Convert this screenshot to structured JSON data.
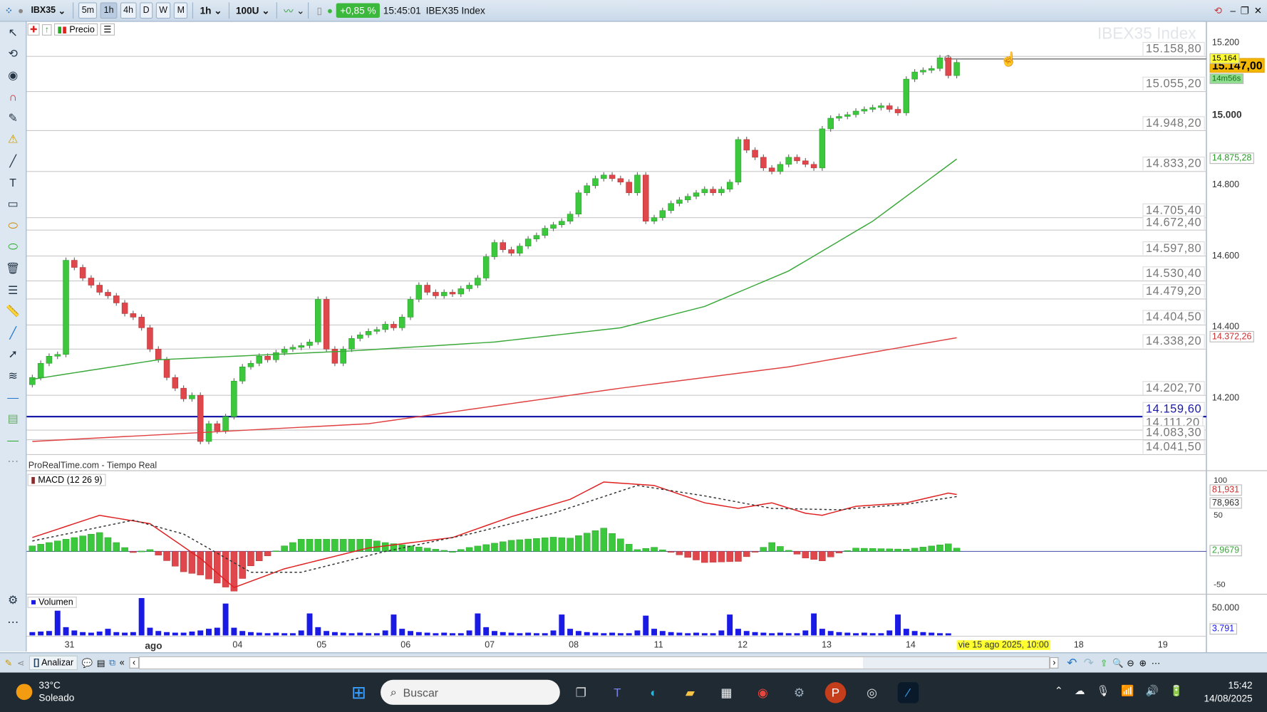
{
  "toolbar": {
    "symbol": "IBX35",
    "timeframes": [
      "5m",
      "1h",
      "4h",
      "D",
      "W",
      "M"
    ],
    "active_timeframe": "1h",
    "interval": "1h",
    "units": "100U",
    "change": "+0,85 %",
    "time": "15:45:01",
    "instrument": "IBEX35 Index"
  },
  "chart_header": {
    "price_label": "Precio",
    "watermark": "IBEX35 Index",
    "source": "ProRealTime.com - Tiempo Real"
  },
  "colors": {
    "up": "#3cc83c",
    "down": "#e0474c",
    "ma_fast": "#3aa83a",
    "ma_slow": "#e04040",
    "level_blue": "#1a1aa8",
    "volume": "#1a1ae6"
  },
  "levels": [
    {
      "label": "15.158,80",
      "price": 15164
    },
    {
      "label": "15.055,20",
      "price": 15065
    },
    {
      "label": "14.948,20",
      "price": 14955
    },
    {
      "label": "14.833,20",
      "price": 14840
    },
    {
      "label": "14.705,40",
      "price": 14710
    },
    {
      "label": "14.672,40",
      "price": 14675
    },
    {
      "label": "14.597,80",
      "price": 14602
    },
    {
      "label": "14.530,40",
      "price": 14532
    },
    {
      "label": "14.479,20",
      "price": 14481
    },
    {
      "label": "14.404,50",
      "price": 14408
    },
    {
      "label": "14.338,20",
      "price": 14340
    },
    {
      "label": "14.202,70",
      "price": 14210
    },
    {
      "label": "14.159,60",
      "price": 14150,
      "blue": true
    },
    {
      "label": "14.111,20",
      "price": 14112
    },
    {
      "label": "14.083,30",
      "price": 14085
    },
    {
      "label": "14.041,50",
      "price": 14043
    }
  ],
  "price_axis": {
    "ticks": [
      {
        "label": "15.200",
        "v": 15200
      },
      {
        "label": "15.000",
        "v": 15000,
        "bold": true
      },
      {
        "label": "14.800",
        "v": 14800
      },
      {
        "label": "14.600",
        "v": 14600
      },
      {
        "label": "14.400",
        "v": 14400
      },
      {
        "label": "14.200",
        "v": 14200
      }
    ],
    "last_price": "15.147,00",
    "crosshair_price": "15.164",
    "countdown": "14m56s",
    "ma_fast_value": "14.875,28",
    "ma_slow_value": "14.372,26"
  },
  "macd": {
    "title": "MACD (12 26 9)",
    "ticks": [
      {
        "label": "100",
        "v": 100
      },
      {
        "label": "50",
        "v": 50
      },
      {
        "label": "-50",
        "v": -50
      }
    ],
    "macd_value": "81,931",
    "signal_value": "78,963",
    "hist_value": "2,9679"
  },
  "volume": {
    "title": "Volumen",
    "tick": "50.000",
    "last": "3.791"
  },
  "date_axis": {
    "labels": [
      "31",
      "ago",
      "04",
      "05",
      "06",
      "07",
      "08",
      "11",
      "12",
      "13",
      "14",
      "18",
      "19"
    ],
    "cursor_label": "vie 15 ago 2025, 10:00"
  },
  "bottom": {
    "analyze": "Analizar"
  },
  "taskbar": {
    "temp": "33°C",
    "weather": "Soleado",
    "search": "Buscar",
    "time": "15:42",
    "date": "14/08/2025"
  },
  "chart_data": {
    "type": "candlestick",
    "title": "IBEX35 Index 1h",
    "ylabel": "Precio",
    "ylim": [
      14000,
      15230
    ],
    "closes": [
      14260,
      14300,
      14320,
      14325,
      14590,
      14570,
      14540,
      14520,
      14500,
      14490,
      14470,
      14440,
      14430,
      14400,
      14340,
      14310,
      14260,
      14230,
      14200,
      14210,
      14080,
      14130,
      14110,
      14150,
      14250,
      14290,
      14300,
      14320,
      14310,
      14330,
      14340,
      14345,
      14350,
      14360,
      14480,
      14340,
      14300,
      14340,
      14370,
      14380,
      14390,
      14395,
      14410,
      14400,
      14430,
      14480,
      14520,
      14500,
      14490,
      14500,
      14495,
      14510,
      14520,
      14540,
      14600,
      14640,
      14620,
      14610,
      14630,
      14650,
      14660,
      14680,
      14690,
      14700,
      14720,
      14780,
      14800,
      14820,
      14830,
      14820,
      14810,
      14780,
      14830,
      14700,
      14710,
      14730,
      14750,
      14760,
      14770,
      14780,
      14790,
      14780,
      14790,
      14810,
      14930,
      14900,
      14880,
      14850,
      14840,
      14860,
      14880,
      14870,
      14860,
      14850,
      14960,
      14990,
      14995,
      15000,
      15010,
      15015,
      15020,
      15025,
      15015,
      15005,
      15100,
      15120,
      15125,
      15130,
      15160,
      15110,
      15147
    ],
    "ma_fast": [
      [
        0,
        14255
      ],
      [
        15,
        14310
      ],
      [
        38,
        14335
      ],
      [
        55,
        14360
      ],
      [
        70,
        14400
      ],
      [
        80,
        14460
      ],
      [
        90,
        14560
      ],
      [
        100,
        14700
      ],
      [
        110,
        14875
      ]
    ],
    "ma_slow": [
      [
        0,
        14080
      ],
      [
        40,
        14130
      ],
      [
        70,
        14230
      ],
      [
        90,
        14290
      ],
      [
        110,
        14372
      ]
    ],
    "macd_line": [
      [
        0,
        20
      ],
      [
        8,
        52
      ],
      [
        14,
        40
      ],
      [
        20,
        -10
      ],
      [
        24,
        -52
      ],
      [
        30,
        -25
      ],
      [
        40,
        5
      ],
      [
        50,
        20
      ],
      [
        57,
        50
      ],
      [
        64,
        75
      ],
      [
        68,
        100
      ],
      [
        74,
        95
      ],
      [
        80,
        70
      ],
      [
        84,
        62
      ],
      [
        88,
        70
      ],
      [
        92,
        55
      ],
      [
        94,
        52
      ],
      [
        98,
        65
      ],
      [
        104,
        70
      ],
      [
        109,
        84
      ],
      [
        110,
        82
      ]
    ],
    "signal_line": [
      [
        0,
        15
      ],
      [
        12,
        45
      ],
      [
        18,
        25
      ],
      [
        26,
        -30
      ],
      [
        32,
        -30
      ],
      [
        42,
        0
      ],
      [
        52,
        25
      ],
      [
        62,
        55
      ],
      [
        72,
        95
      ],
      [
        80,
        80
      ],
      [
        88,
        62
      ],
      [
        96,
        60
      ],
      [
        104,
        68
      ],
      [
        110,
        79
      ]
    ],
    "volume": [
      6000,
      7000,
      8000,
      45000,
      15000,
      9000,
      6000,
      5000,
      7000,
      12000,
      6000,
      5000,
      6000,
      68000,
      14000,
      8000,
      6000,
      5000,
      5000,
      7000,
      9000,
      12000,
      14000,
      58000,
      14000,
      8000,
      6000,
      5000,
      4000,
      5000,
      4000,
      4000,
      9000,
      40000,
      15000,
      8000,
      6000,
      5000,
      4000,
      5000,
      4000,
      4000,
      9000,
      38000,
      12000,
      8000,
      6000,
      5000,
      4000,
      5000,
      4000,
      4000,
      9000,
      40000,
      15000,
      8000,
      6000,
      5000,
      4000,
      5000,
      4000,
      4000,
      9000,
      38000,
      12000,
      8000,
      6000,
      5000,
      4000,
      5000,
      4000,
      4000,
      9000,
      36000,
      12000,
      8000,
      6000,
      5000,
      4000,
      5000,
      4000,
      4000,
      9000,
      38000,
      12000,
      8000,
      6000,
      5000,
      4000,
      5000,
      4000,
      4000,
      9000,
      40000,
      12000,
      8000,
      6000,
      5000,
      4000,
      5000,
      4000,
      4000,
      9000,
      38000,
      12000,
      8000,
      6000,
      5000,
      4000,
      3791
    ]
  }
}
